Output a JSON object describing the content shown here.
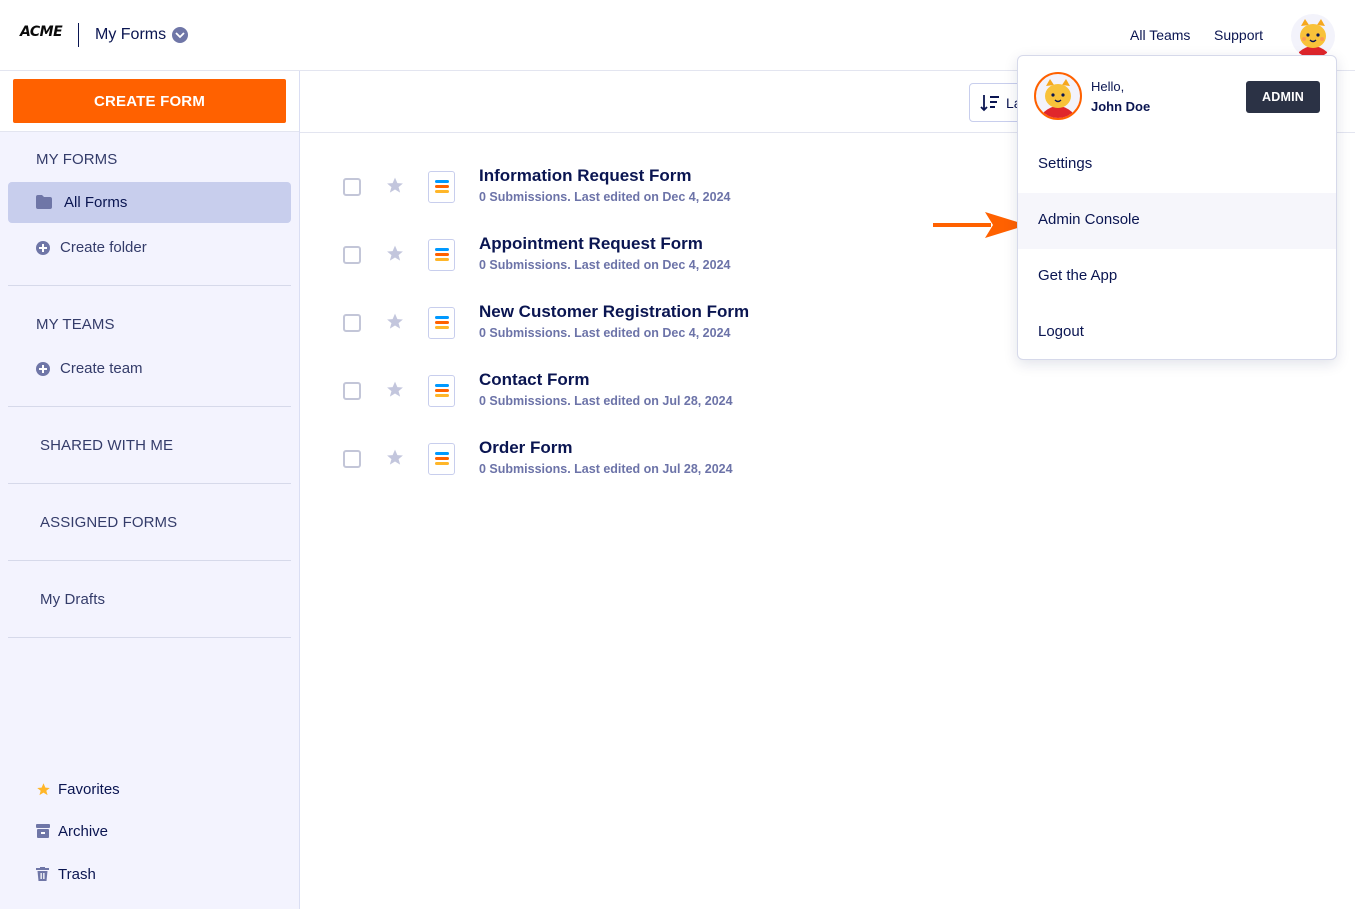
{
  "header": {
    "logo": "ACME",
    "title": "My Forms",
    "links": [
      "All Teams",
      "Support"
    ]
  },
  "sidebar": {
    "create_label": "CREATE FORM",
    "my_forms_title": "MY FORMS",
    "all_forms_label": "All Forms",
    "create_folder_label": "Create folder",
    "my_teams_title": "MY TEAMS",
    "create_team_label": "Create team",
    "shared_title": "SHARED WITH ME",
    "assigned_title": "ASSIGNED FORMS",
    "drafts_label": "My Drafts",
    "favorites_label": "Favorites",
    "archive_label": "Archive",
    "trash_label": "Trash"
  },
  "toolbar": {
    "sort_label": "La"
  },
  "forms": [
    {
      "title": "Information Request Form",
      "meta": "0 Submissions. Last edited on Dec 4, 2024"
    },
    {
      "title": "Appointment Request Form",
      "meta": "0 Submissions. Last edited on Dec 4, 2024"
    },
    {
      "title": "New Customer Registration Form",
      "meta": "0 Submissions. Last edited on Dec 4, 2024"
    },
    {
      "title": "Contact Form",
      "meta": "0 Submissions. Last edited on Jul 28, 2024"
    },
    {
      "title": "Order Form",
      "meta": "0 Submissions. Last edited on Jul 28, 2024"
    }
  ],
  "user_menu": {
    "hello": "Hello,",
    "name": "John Doe",
    "badge": "ADMIN",
    "items": [
      "Settings",
      "Admin Console",
      "Get the App",
      "Logout"
    ]
  },
  "colors": {
    "accent": "#ff6100",
    "navy": "#0a1551",
    "sidebar_bg": "#f3f3fe",
    "active_item": "#c8ceed"
  }
}
